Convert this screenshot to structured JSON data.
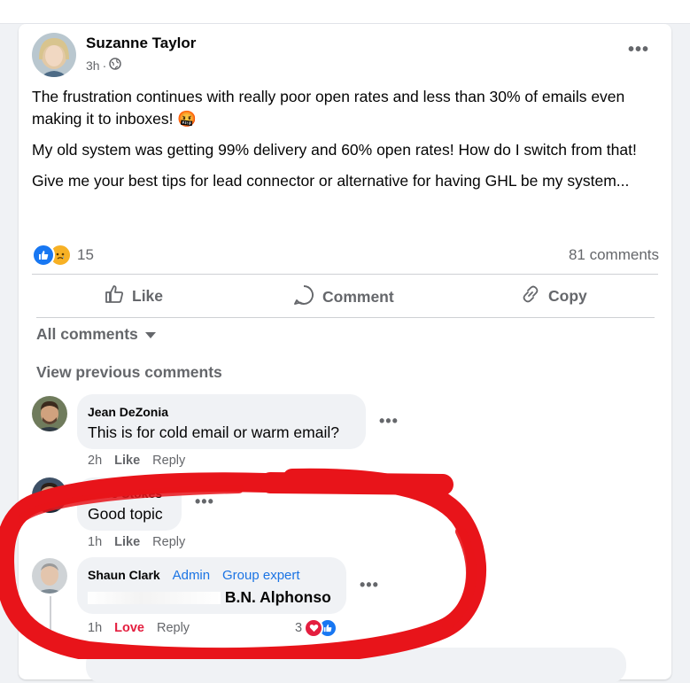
{
  "post": {
    "author": "Suzanne Taylor",
    "time": "3h",
    "separator": "·",
    "audience_icon": "globe-icon",
    "paragraphs": [
      "The frustration continues with really poor open rates and less than 30% of emails even making it to inboxes! 🤬",
      "My old system was getting 99% delivery and 60% open rates! How do I switch from that!",
      "Give me your best tips for lead connector or alternative for having GHL be my system..."
    ],
    "reaction_count": "15",
    "comment_count": "81 comments"
  },
  "actions": {
    "like": "Like",
    "comment": "Comment",
    "copy": "Copy"
  },
  "filter": {
    "label": "All comments"
  },
  "view_previous": "View previous comments",
  "comments": [
    {
      "author": "Jean DeZonia",
      "text": "This is for cold email or warm email?",
      "time": "2h",
      "like": "Like",
      "reply": "Reply"
    },
    {
      "author": "Ross Stokes",
      "text": "Good topic",
      "time": "1h",
      "like": "Like",
      "reply": "Reply"
    },
    {
      "author": "Shaun Clark",
      "badge1": "Admin",
      "badge2": "Group expert",
      "text_visible": "B.N. Alphonso",
      "time": "1h",
      "like": "Love",
      "reply": "Reply",
      "reaction_count": "3"
    }
  ],
  "colors": {
    "accent": "#1877f2",
    "love": "#e41e3f",
    "scrawl": "#e8141a"
  }
}
